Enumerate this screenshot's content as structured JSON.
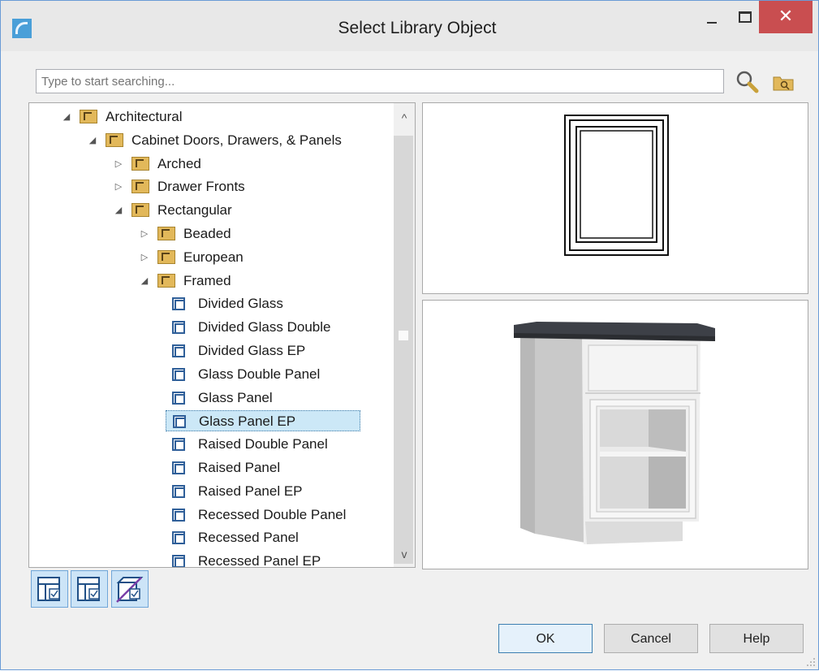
{
  "window": {
    "title": "Select Library Object",
    "close_glyph": "✕"
  },
  "search": {
    "placeholder": "Type to start searching...",
    "value": ""
  },
  "tree": {
    "items": [
      {
        "label": "Architectural",
        "type": "folder",
        "state": "expanded"
      },
      {
        "label": "Cabinet Doors, Drawers, & Panels",
        "type": "folder",
        "state": "expanded"
      },
      {
        "label": "Arched",
        "type": "folder",
        "state": "collapsed"
      },
      {
        "label": "Drawer Fronts",
        "type": "folder",
        "state": "collapsed"
      },
      {
        "label": "Rectangular",
        "type": "folder",
        "state": "expanded"
      },
      {
        "label": "Beaded",
        "type": "folder",
        "state": "collapsed"
      },
      {
        "label": "European",
        "type": "folder",
        "state": "collapsed"
      },
      {
        "label": "Framed",
        "type": "folder",
        "state": "expanded"
      },
      {
        "label": "Divided Glass",
        "type": "object"
      },
      {
        "label": "Divided Glass Double",
        "type": "object"
      },
      {
        "label": "Divided Glass EP",
        "type": "object"
      },
      {
        "label": "Glass Double Panel",
        "type": "object"
      },
      {
        "label": "Glass Panel",
        "type": "object"
      },
      {
        "label": "Glass Panel EP",
        "type": "object",
        "selected": true
      },
      {
        "label": "Raised Double Panel",
        "type": "object"
      },
      {
        "label": "Raised Panel",
        "type": "object"
      },
      {
        "label": "Raised Panel EP",
        "type": "object"
      },
      {
        "label": "Recessed Double Panel",
        "type": "object"
      },
      {
        "label": "Recessed Panel",
        "type": "object"
      },
      {
        "label": "Recessed Panel EP",
        "type": "object"
      }
    ]
  },
  "scroll": {
    "up_glyph": "^",
    "down_glyph": "v"
  },
  "buttons": {
    "ok": "OK",
    "cancel": "Cancel",
    "help": "Help"
  },
  "colors": {
    "selection": "#cce8f7",
    "folder": "#e2b85a",
    "object_icon": "#2f5f99",
    "close_button": "#c94e50",
    "toolbar_button": "#cce4f7"
  },
  "icons": [
    "search-icon",
    "folder-browse-icon",
    "preview-2d-icon",
    "preview-3d-icon",
    "show-3d-toggle-icon"
  ]
}
